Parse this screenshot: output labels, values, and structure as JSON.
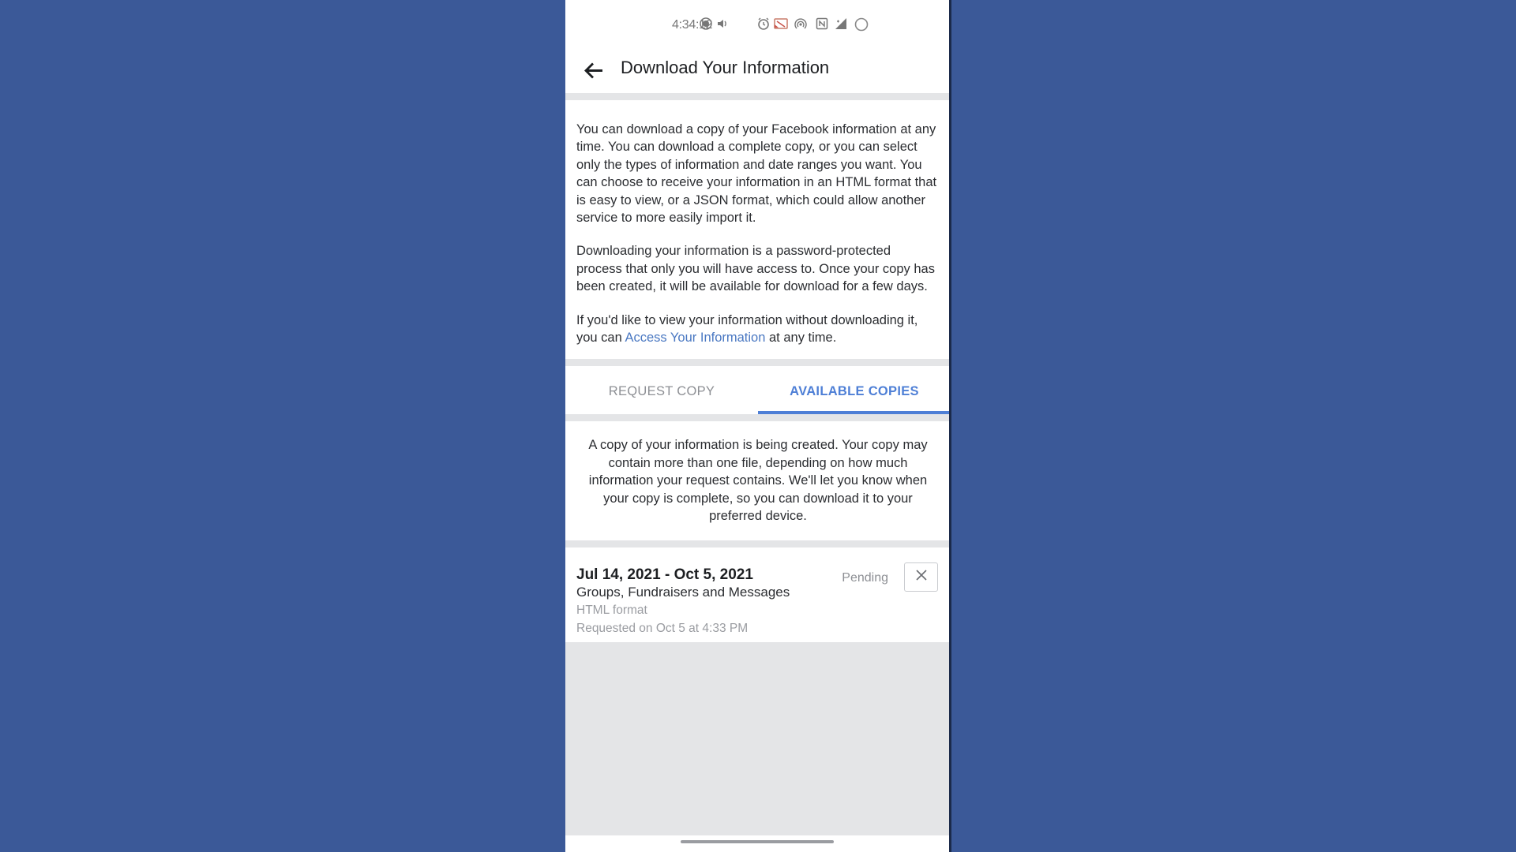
{
  "status_bar": {
    "time": "4:34:12",
    "icons": [
      "record-icon",
      "volume-icon",
      "alarm-icon",
      "cast-icon",
      "hotspot-icon",
      "nfc-icon",
      "signal-icon",
      "battery-icon"
    ]
  },
  "header": {
    "title": "Download Your Information"
  },
  "intro": {
    "paragraph1": "You can download a copy of your Facebook information at any time. You can download a complete copy, or you can select only the types of information and date ranges you want. You can choose to receive your information in an HTML format that is easy to view, or a JSON format, which could allow another service to more easily import it.",
    "paragraph2": "Downloading your information is a password-protected process that only you will have access to. Once your copy has been created, it will be available for download for a few days.",
    "paragraph3_before": "If you'd like to view your information without downloading it, you can ",
    "paragraph3_link": "Access Your Information",
    "paragraph3_after": " at any time."
  },
  "tabs": [
    {
      "label": "REQUEST COPY",
      "active": false
    },
    {
      "label": "AVAILABLE COPIES",
      "active": true
    }
  ],
  "notice": "A copy of your information is being created. Your copy may contain more than one file, depending on how much information your request contains. We'll let you know when your copy is complete, so you can download it to your preferred device.",
  "copy": {
    "date_range": "Jul 14, 2021 - Oct 5, 2021",
    "categories": "Groups, Fundraisers and Messages",
    "format": "HTML format",
    "requested": "Requested on Oct 5 at 4:33 PM",
    "status": "Pending"
  },
  "colors": {
    "background": "#3b5998",
    "accent": "#4e7fd6",
    "link": "#4a78c2"
  }
}
